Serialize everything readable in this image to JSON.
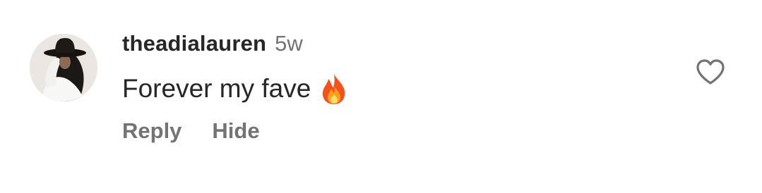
{
  "comment": {
    "username": "theadialauren",
    "time": "5w",
    "text": "Forever my fave",
    "emoji": "fire-emoji"
  },
  "actions": {
    "reply_label": "Reply",
    "hide_label": "Hide"
  },
  "icons": {
    "like": "heart-outline-icon"
  },
  "colors": {
    "text_primary": "#262626",
    "text_secondary": "#737373",
    "background": "#ffffff"
  }
}
